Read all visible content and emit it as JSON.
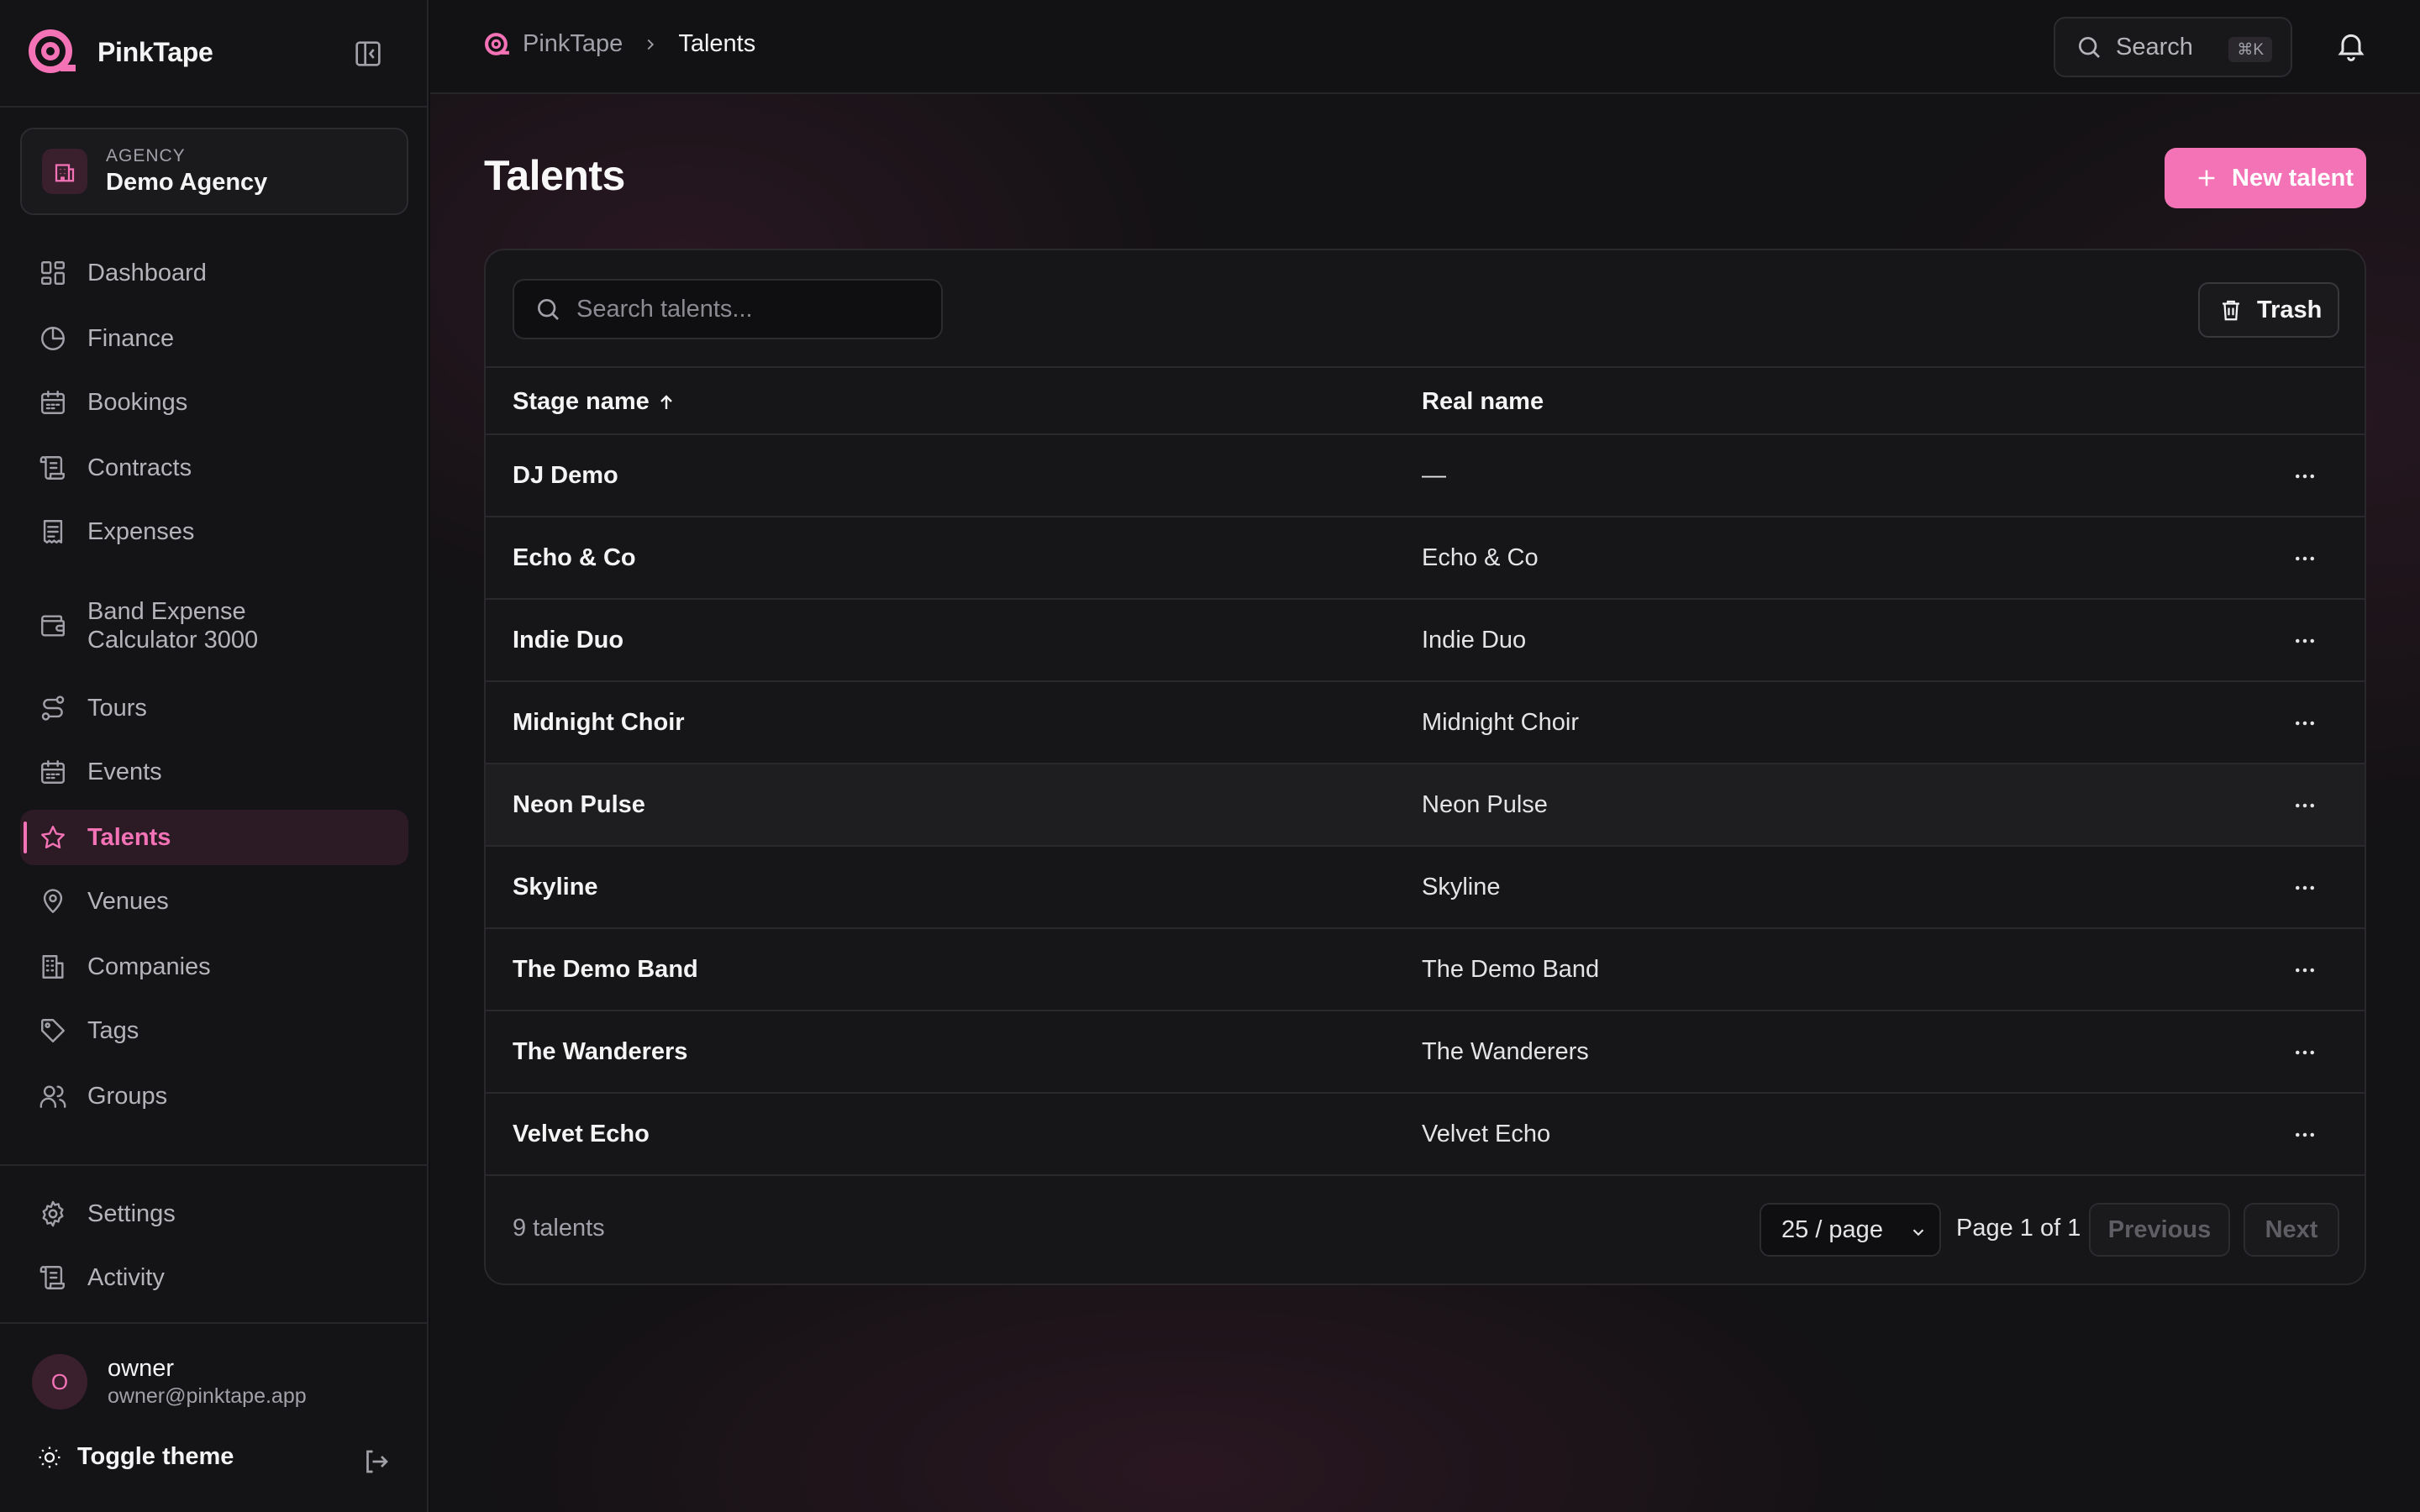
{
  "brand": {
    "name": "PinkTape"
  },
  "agency": {
    "label": "AGENCY",
    "name": "Demo Agency"
  },
  "nav": [
    {
      "label": "Dashboard",
      "icon": "grid-icon",
      "active": false
    },
    {
      "label": "Finance",
      "icon": "pie-chart-icon",
      "active": false
    },
    {
      "label": "Bookings",
      "icon": "calendar-icon",
      "active": false
    },
    {
      "label": "Contracts",
      "icon": "scroll-icon",
      "active": false
    },
    {
      "label": "Expenses",
      "icon": "receipt-icon",
      "active": false
    },
    {
      "label": "Band Expense Calculator 3000",
      "icon": "wallet-icon",
      "active": false
    },
    {
      "label": "Tours",
      "icon": "route-icon",
      "active": false
    },
    {
      "label": "Events",
      "icon": "calendar-icon",
      "active": false
    },
    {
      "label": "Talents",
      "icon": "star-icon",
      "active": true
    },
    {
      "label": "Venues",
      "icon": "map-pin-icon",
      "active": false
    },
    {
      "label": "Companies",
      "icon": "building-icon",
      "active": false
    },
    {
      "label": "Tags",
      "icon": "tag-icon",
      "active": false
    },
    {
      "label": "Groups",
      "icon": "users-icon",
      "active": false
    }
  ],
  "bottom_nav": [
    {
      "label": "Settings",
      "icon": "gear-icon"
    },
    {
      "label": "Activity",
      "icon": "scroll-icon"
    }
  ],
  "user": {
    "initial": "O",
    "name": "owner",
    "email": "owner@pinktape.app"
  },
  "theme_toggle": {
    "label": "Toggle theme"
  },
  "breadcrumb": {
    "root": "PinkTape",
    "current": "Talents"
  },
  "topbar": {
    "search_label": "Search",
    "search_shortcut": "⌘K"
  },
  "page": {
    "title": "Talents",
    "new_button": "New talent"
  },
  "table": {
    "search_placeholder": "Search talents...",
    "trash_label": "Trash",
    "columns": {
      "stage_name": "Stage name",
      "real_name": "Real name"
    },
    "rows": [
      {
        "stage_name": "DJ Demo",
        "real_name": "—"
      },
      {
        "stage_name": "Echo & Co",
        "real_name": "Echo & Co"
      },
      {
        "stage_name": "Indie Duo",
        "real_name": "Indie Duo"
      },
      {
        "stage_name": "Midnight Choir",
        "real_name": "Midnight Choir"
      },
      {
        "stage_name": "Neon Pulse",
        "real_name": "Neon Pulse"
      },
      {
        "stage_name": "Skyline",
        "real_name": "Skyline"
      },
      {
        "stage_name": "The Demo Band",
        "real_name": "The Demo Band"
      },
      {
        "stage_name": "The Wanderers",
        "real_name": "The Wanderers"
      },
      {
        "stage_name": "Velvet Echo",
        "real_name": "Velvet Echo"
      }
    ],
    "count_text": "9 talents",
    "per_page": "25 / page",
    "page_info": "Page 1 of 1",
    "prev_label": "Previous",
    "next_label": "Next"
  },
  "colors": {
    "accent": "#f472b6",
    "background": "#131214",
    "sidebar": "#141315"
  }
}
